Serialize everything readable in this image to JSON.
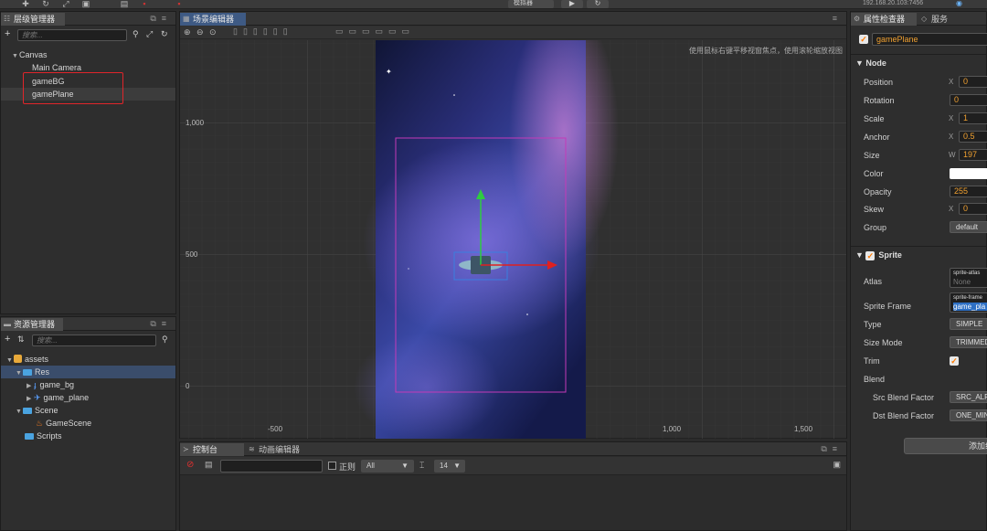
{
  "topbar": {
    "preview_mode": "模拟器",
    "ip": "192.168.20.103:7456"
  },
  "hierarchy": {
    "title": "层级管理器",
    "search_placeholder": "搜索...",
    "items": [
      {
        "label": "Canvas"
      },
      {
        "label": "Main Camera"
      },
      {
        "label": "gameBG"
      },
      {
        "label": "gamePlane"
      }
    ]
  },
  "assets": {
    "title": "资源管理器",
    "search_placeholder": "搜索...",
    "items": [
      {
        "label": "assets"
      },
      {
        "label": "Res"
      },
      {
        "label": "game_bg"
      },
      {
        "label": "game_plane"
      },
      {
        "label": "Scene"
      },
      {
        "label": "GameScene"
      },
      {
        "label": "Scripts"
      }
    ]
  },
  "scene": {
    "title": "场景编辑器",
    "hint": "使用鼠标右键平移视窗焦点，使用滚轮缩放视图",
    "y_labels": [
      "1,000",
      "500",
      "0"
    ],
    "x_labels": [
      "-500",
      "1,000",
      "1,500"
    ]
  },
  "console": {
    "tab_console": "控制台",
    "tab_anim": "动画编辑器",
    "regex_label": "正则",
    "level": "All",
    "font_size": "14"
  },
  "inspector": {
    "tab_props": "属性检查器",
    "tab_service": "服务",
    "node_name": "gamePlane",
    "node_section": "Node",
    "rows": {
      "position": {
        "label": "Position",
        "axis": "X",
        "value": "0"
      },
      "rotation": {
        "label": "Rotation",
        "value": "0"
      },
      "scale": {
        "label": "Scale",
        "axis": "X",
        "value": "1"
      },
      "anchor": {
        "label": "Anchor",
        "axis": "X",
        "value": "0.5"
      },
      "size": {
        "label": "Size",
        "axis": "W",
        "value": "197"
      },
      "color": {
        "label": "Color"
      },
      "opacity": {
        "label": "Opacity",
        "value": "255"
      },
      "skew": {
        "label": "Skew",
        "axis": "X",
        "value": "0"
      },
      "group": {
        "label": "Group",
        "value": "default"
      }
    },
    "sprite_section": "Sprite",
    "sprite": {
      "atlas_label": "Atlas",
      "atlas_tag": "sprite-atlas",
      "atlas_value": "None",
      "frame_label": "Sprite Frame",
      "frame_tag": "sprite-frame",
      "frame_value": "game_pla",
      "type_label": "Type",
      "type_value": "SIMPLE",
      "sizemode_label": "Size Mode",
      "sizemode_value": "TRIMMED",
      "trim_label": "Trim",
      "blend_label": "Blend",
      "src_label": "Src Blend Factor",
      "src_value": "SRC_ALP",
      "dst_label": "Dst Blend Factor",
      "dst_value": "ONE_MIN"
    },
    "add_component": "添加组"
  }
}
